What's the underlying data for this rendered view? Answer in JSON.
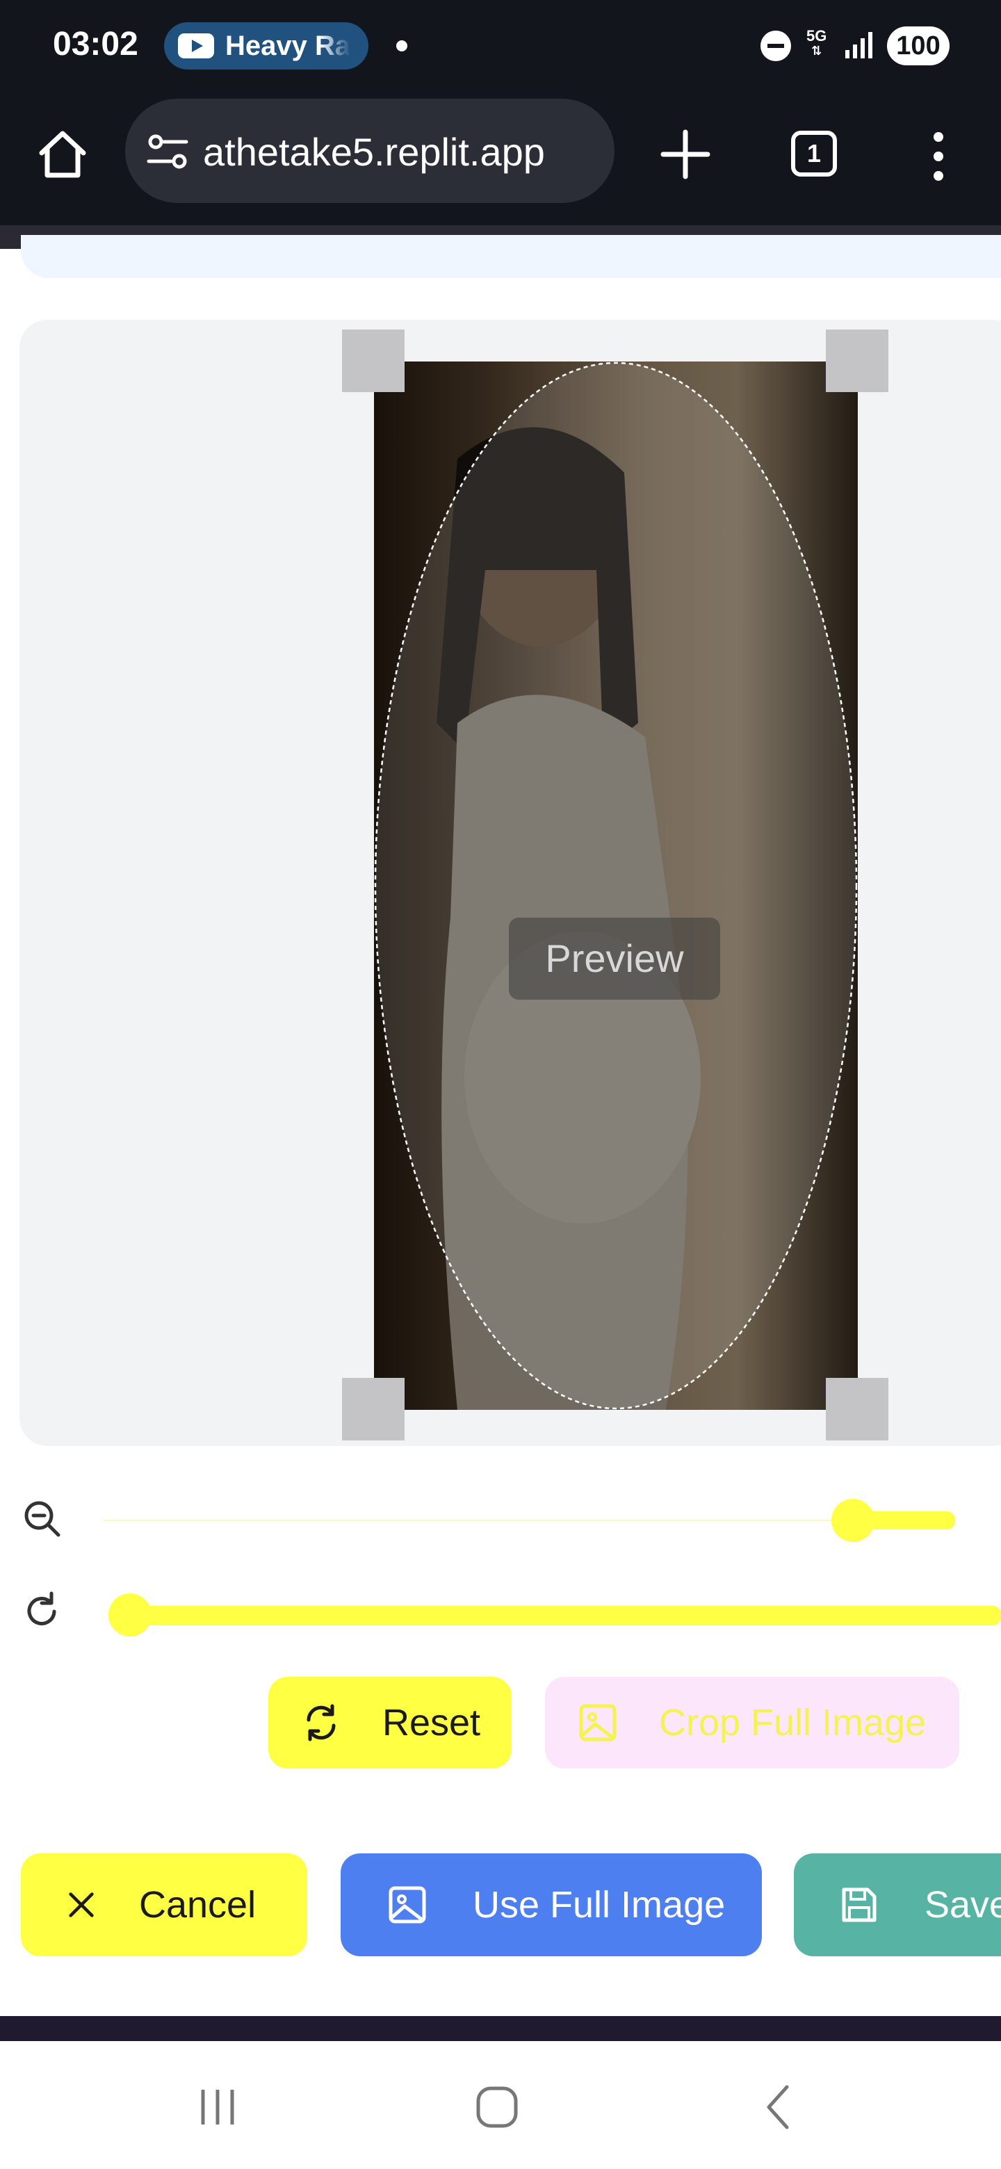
{
  "status_bar": {
    "time": "03:02",
    "media_chip": "Heavy Ra",
    "network": "5G",
    "battery": "100"
  },
  "browser": {
    "url": "athetake5.replit.app",
    "tab_count": "1"
  },
  "editor": {
    "preview_label": "Preview",
    "zoom_level": 0.88,
    "rotation_level": 0.0,
    "reset_label": "Reset",
    "crop_full_label": "Crop Full Image",
    "cancel_label": "Cancel",
    "use_full_label": "Use Full Image",
    "save_label": "Save"
  },
  "colors": {
    "accent_yellow": "#ffff43",
    "primary_blue": "#4d7ff0",
    "save_teal": "#57b4a5",
    "disabled_pink": "#fbe6fb"
  },
  "icons": {
    "zoom": "zoom-out-icon",
    "rotate": "rotate-icon",
    "reset": "refresh-icon",
    "crop": "image-icon",
    "cancel": "close-icon",
    "save": "floppy-disk-icon"
  }
}
